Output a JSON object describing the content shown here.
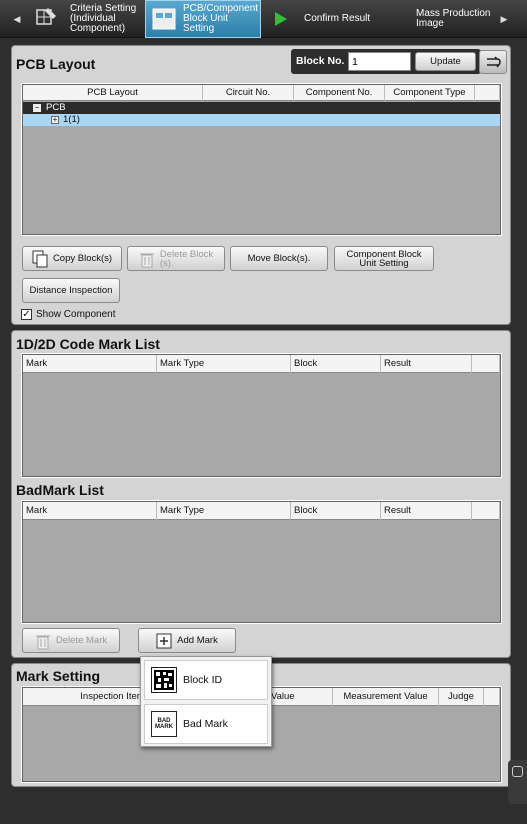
{
  "wizard": {
    "prev_arrow": "◀",
    "next_arrow": "▶",
    "steps": [
      {
        "label": "Criteria Setting\n(Individual\nComponent)"
      },
      {
        "label": "PCB/Component\nBlock Unit\nSetting"
      },
      {
        "label": "Confirm Result"
      },
      {
        "label": "Mass Production\nImage"
      }
    ]
  },
  "pcb_layout": {
    "title": "PCB Layout",
    "block_no_label": "Block No.",
    "block_no_value": "1",
    "update_label": "Update",
    "columns": [
      "PCB Layout",
      "Circuit No.",
      "Component No.",
      "Component Type"
    ],
    "tree": [
      {
        "expander": "−",
        "text": "PCB"
      },
      {
        "expander": "+",
        "text": "1(1)"
      }
    ],
    "buttons": {
      "copy": "Copy Block(s)",
      "delete": "Delete Block\n(s).",
      "move": "Move Block(s).",
      "component_setting": "Component Block\nUnit Setting",
      "distance": "Distance Inspection"
    },
    "show_component_label": "Show Component",
    "show_component_checked": true
  },
  "code_mark": {
    "title": "1D/2D Code Mark List",
    "columns": [
      "Mark",
      "Mark Type",
      "Block",
      "Result"
    ]
  },
  "badmark": {
    "title": "BadMark List",
    "columns": [
      "Mark",
      "Mark Type",
      "Block",
      "Result"
    ],
    "delete_label": "Delete Mark",
    "add_label": "Add Mark"
  },
  "mark_setting": {
    "title": "Mark Setting",
    "columns": [
      "Inspection Item",
      "Value",
      "Measurement Value",
      "Judge"
    ]
  },
  "add_mark_menu": {
    "items": [
      {
        "label": "Block ID",
        "icon": "block-id-icon"
      },
      {
        "label": "Bad Mark",
        "icon": "bad-mark-icon",
        "icon_text": "BAD\nMARK"
      }
    ]
  }
}
